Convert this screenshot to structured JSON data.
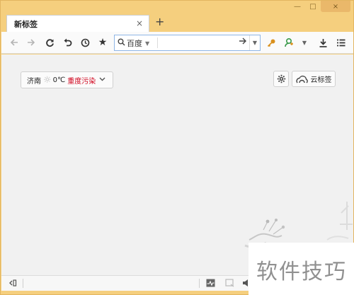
{
  "tab": {
    "title": "新标签",
    "close": "×",
    "new_tab": "+"
  },
  "window_controls": {
    "minimize": "—",
    "maximize": "□",
    "close": "×"
  },
  "toolbar": {
    "back_icon": "arrow-left-icon",
    "forward_icon": "arrow-right-icon",
    "refresh_icon": "refresh-icon",
    "undo_icon": "undo-icon",
    "history_icon": "clock-icon",
    "favorite_icon": "star-icon",
    "key_icon": "key-icon",
    "user_icon": "user-icon",
    "download_icon": "download-icon",
    "menu_icon": "menu-icon"
  },
  "search": {
    "engine": "百度",
    "value": "",
    "placeholder": ""
  },
  "weather": {
    "city": "济南",
    "temperature": "0℃",
    "pollution": "重度污染"
  },
  "cloud_tabs": {
    "label": "云标签"
  },
  "watermark": {
    "text": "软件技巧"
  },
  "colors": {
    "frame": "#f5cf7e",
    "accent": "#8fb6e6",
    "pollution": "#d0021b"
  }
}
